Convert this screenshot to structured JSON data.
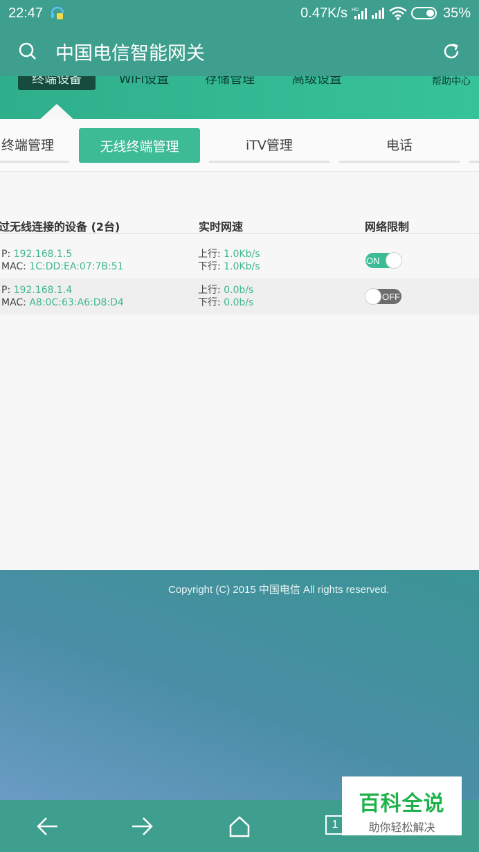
{
  "status_bar": {
    "time": "22:47",
    "net_speed": "0.47K/s",
    "battery": "35%"
  },
  "app_bar": {
    "title": "中国电信智能网关"
  },
  "top_nav": {
    "items": [
      "终端设备",
      "WiFi设置",
      "存储管理",
      "高级设置",
      "帮助中心"
    ]
  },
  "sub_tabs": {
    "items": [
      "终端管理",
      "无线终端管理",
      "iTV管理",
      "电话"
    ],
    "active_index": 1
  },
  "table": {
    "headers": [
      "过无线连接的设备 (2台)",
      "实时网速",
      "网络限制"
    ],
    "rows": [
      {
        "ip_label": "P:",
        "ip": "192.168.1.5",
        "mac_label": "MAC:",
        "mac": "1C:DD:EA:07:7B:51",
        "up_label": "上行:",
        "up": "1.0Kb/s",
        "down_label": "下行:",
        "down": "1.0Kb/s",
        "toggle": "ON"
      },
      {
        "ip_label": "P:",
        "ip": "192.168.1.4",
        "mac_label": "MAC:",
        "mac": "A8:0C:63:A6:D8:D4",
        "up_label": "上行:",
        "up": "0.0b/s",
        "down_label": "下行:",
        "down": "0.0b/s",
        "toggle": "OFF"
      }
    ]
  },
  "footer": {
    "copyright": "Copyright (C) 2015 中国电信 All rights reserved."
  },
  "bottom_bar": {
    "tab_count": "1"
  },
  "watermark": {
    "title": "百科全说",
    "subtitle": "助你轻松解决"
  },
  "colors": {
    "header": "#3e9f8e",
    "accent": "#3dbb95",
    "value_text": "#3fb68f"
  }
}
